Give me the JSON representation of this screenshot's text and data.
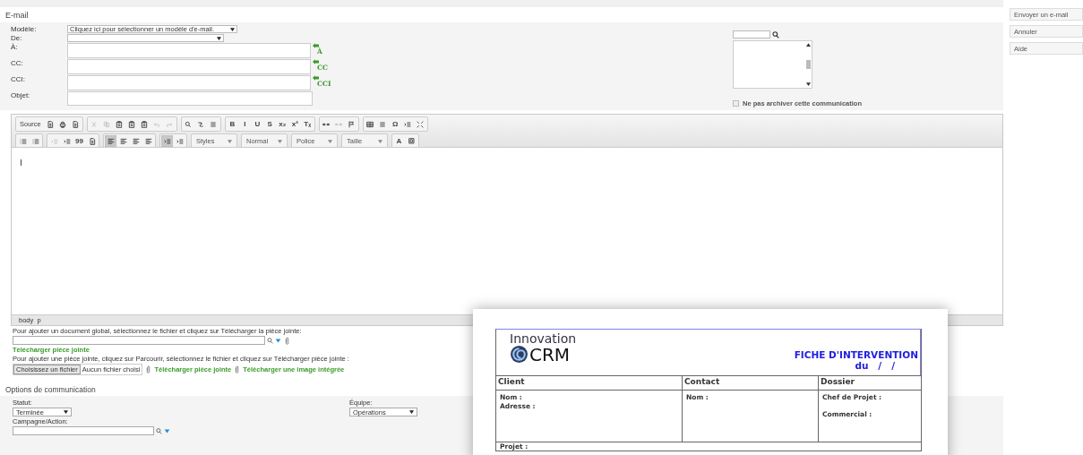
{
  "header": {
    "title": "E-mail"
  },
  "form": {
    "fields": [
      {
        "label": "Modèle:",
        "kind": "select",
        "value": "Cliquez ici pour sélectionner un modèle d'e-mail."
      },
      {
        "label": "De:",
        "kind": "select"
      },
      {
        "label": "À:",
        "kind": "recipients",
        "link": "À"
      },
      {
        "label": "CC:",
        "kind": "recipients",
        "link": "CC"
      },
      {
        "label": "CCI:",
        "kind": "recipients",
        "link": "CCI"
      },
      {
        "label": "Objet:",
        "kind": "text"
      }
    ]
  },
  "contacts_panel": {
    "archive_checkbox": {
      "label": "Ne pas archiver cette communication",
      "checked": false
    }
  },
  "editor": {
    "toolbar_rows": [
      [
        [
          {
            "kind": "source",
            "label": "Source",
            "disabled": false,
            "on": false
          },
          {
            "kind": "page",
            "disabled": false,
            "on": false
          },
          {
            "kind": "print",
            "disabled": false,
            "on": false
          },
          {
            "kind": "page",
            "disabled": false,
            "on": false
          }
        ],
        [
          {
            "kind": "cut",
            "disabled": true,
            "on": false
          },
          {
            "kind": "copy",
            "disabled": true,
            "on": false
          },
          {
            "kind": "paste",
            "disabled": false,
            "on": false
          },
          {
            "kind": "paste",
            "disabled": false,
            "on": false
          },
          {
            "kind": "paste",
            "disabled": false,
            "on": false
          },
          {
            "kind": "undo",
            "disabled": true,
            "on": false
          },
          {
            "kind": "redo",
            "disabled": true,
            "on": false
          }
        ],
        [
          {
            "kind": "find",
            "disabled": false,
            "on": false
          },
          {
            "kind": "replace",
            "disabled": false,
            "on": false
          },
          {
            "kind": "lines",
            "disabled": false,
            "on": false
          }
        ],
        [
          {
            "kind": "glyph",
            "text": "B",
            "disabled": false,
            "on": false
          },
          {
            "kind": "glyph",
            "text": "I",
            "disabled": false,
            "on": false
          },
          {
            "kind": "glyph",
            "text": "U",
            "disabled": false,
            "on": false
          },
          {
            "kind": "glyph",
            "text": "S",
            "disabled": false,
            "on": false
          },
          {
            "kind": "glyph",
            "text": "x₂",
            "disabled": false,
            "on": false
          },
          {
            "kind": "glyph",
            "text": "x²",
            "disabled": false,
            "on": false
          },
          {
            "kind": "glyph",
            "text": "Tₓ",
            "disabled": false,
            "on": false
          }
        ],
        [
          {
            "kind": "link",
            "disabled": false,
            "on": false
          },
          {
            "kind": "link",
            "disabled": true,
            "on": false
          },
          {
            "kind": "flag",
            "disabled": false,
            "on": false
          }
        ],
        [
          {
            "kind": "table",
            "disabled": false,
            "on": false
          },
          {
            "kind": "lines",
            "disabled": false,
            "on": false
          },
          {
            "kind": "glyph",
            "text": "Ω",
            "disabled": false,
            "on": false
          },
          {
            "kind": "indent",
            "disabled": false,
            "on": false
          },
          {
            "kind": "maximize",
            "disabled": false,
            "on": false
          }
        ]
      ],
      [
        [
          {
            "kind": "list",
            "disabled": false,
            "on": false
          },
          {
            "kind": "list",
            "disabled": false,
            "on": false
          }
        ],
        [
          {
            "kind": "indent",
            "disabled": true,
            "on": false
          },
          {
            "kind": "indent",
            "disabled": false,
            "on": false
          },
          {
            "kind": "glyph",
            "text": "99",
            "disabled": false,
            "on": false
          },
          {
            "kind": "page",
            "disabled": false,
            "on": false
          }
        ],
        [
          {
            "kind": "align",
            "disabled": false,
            "on": true
          },
          {
            "kind": "align",
            "disabled": false,
            "on": false
          },
          {
            "kind": "align",
            "disabled": false,
            "on": false
          },
          {
            "kind": "align",
            "disabled": false,
            "on": false
          }
        ],
        [
          {
            "kind": "indent",
            "disabled": false,
            "on": true
          },
          {
            "kind": "indent",
            "disabled": false,
            "on": false
          }
        ],
        [
          {
            "kind": "combo",
            "label": "Styles",
            "disabled": false,
            "on": false
          }
        ],
        [
          {
            "kind": "combo",
            "label": "Normal",
            "disabled": false,
            "on": false
          }
        ],
        [
          {
            "kind": "combo",
            "label": "Police",
            "disabled": false,
            "on": false
          }
        ],
        [
          {
            "kind": "combo",
            "label": "Taille",
            "disabled": false,
            "on": false
          }
        ],
        [
          {
            "kind": "color",
            "text": "A",
            "disabled": false,
            "on": false
          },
          {
            "kind": "bgcolor",
            "disabled": false,
            "on": false
          }
        ]
      ]
    ],
    "path": "body  p"
  },
  "attachments": {
    "global_hint": "Pour ajouter un document global, sélectionnez le fichier et cliquez sur Télécharger la pièce jointe:",
    "global_link": "Télécharger pièce jointe",
    "file_hint": "Pour ajouter une pièce jointe, cliquez sur Parcourir, sélectionnez le fichier et cliquez sur Télécharger pièce jointe :",
    "choose_button": "Choisissez un fichier",
    "no_file": "Aucun fichier choisi",
    "links": [
      "Télécharger pièce jointe",
      "Télécharger une image intégrée"
    ]
  },
  "options": {
    "title": "Options de communication",
    "status": {
      "label": "Statut:",
      "value": "Terminée"
    },
    "team": {
      "label": "Équipe:",
      "value": "Opérations"
    },
    "campaign": {
      "label": "Campagne/Action:"
    }
  },
  "actions": [
    {
      "label": "Envoyer un e-mail"
    },
    {
      "label": "Annuler"
    },
    {
      "label": "Aide"
    }
  ],
  "document": {
    "logo_top": "Innovation",
    "logo_bottom": "CRM",
    "title": "FICHE D'INTERVENTION",
    "date": "du   /   /",
    "columns": [
      "Client",
      "Contact",
      "Dossier"
    ],
    "cells": [
      [
        "Nom :",
        "Adresse :"
      ],
      [
        "Nom :"
      ],
      [
        "Chef de Projet :",
        "Commercial :"
      ]
    ],
    "footer_row": "Projet :"
  }
}
